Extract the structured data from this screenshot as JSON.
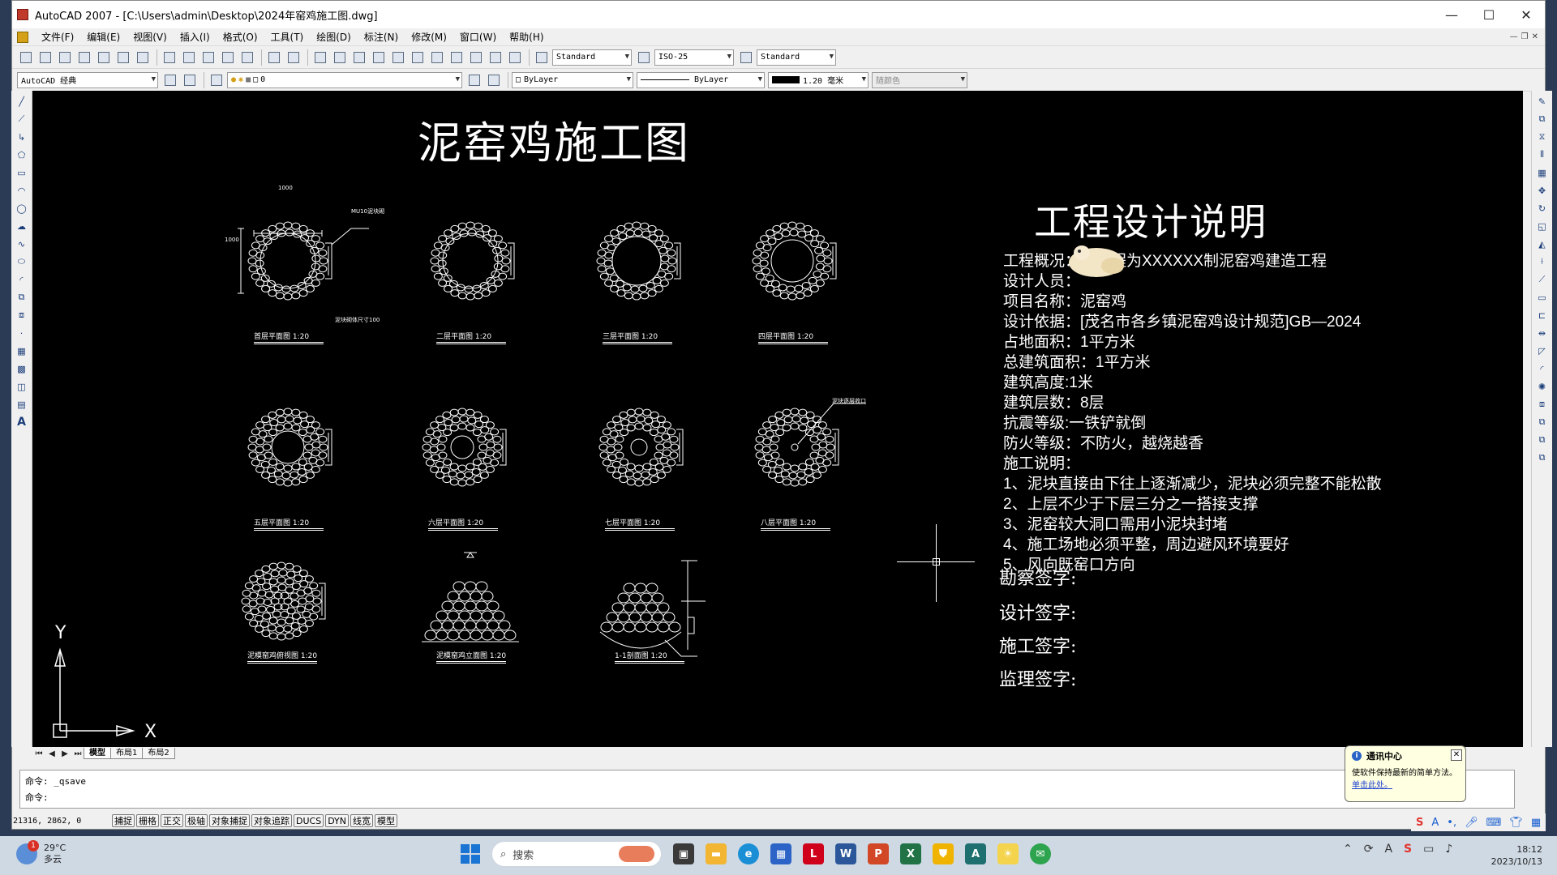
{
  "window": {
    "title": "AutoCAD 2007 - [C:\\Users\\admin\\Desktop\\2024年窑鸡施工图.dwg]",
    "controls": [
      "—",
      "☐",
      "✕"
    ]
  },
  "menu": {
    "items": [
      "文件(F)",
      "编辑(E)",
      "视图(V)",
      "插入(I)",
      "格式(O)",
      "工具(T)",
      "绘图(D)",
      "标注(N)",
      "修改(M)",
      "窗口(W)",
      "帮助(H)"
    ]
  },
  "toolbar1": {
    "text_style": "Standard",
    "dim_style": "ISO-25",
    "table_style": "Standard"
  },
  "toolbar2": {
    "workspace": "AutoCAD 经典",
    "layer": "0",
    "color": "ByLayer",
    "linetype": "ByLayer",
    "lineweight": "1.20 毫米",
    "plotstyle": "随颜色"
  },
  "drawing": {
    "title": "泥窑鸡施工图",
    "plans": [
      {
        "label": "首层平面图  1:20",
        "note_top": "1000",
        "note_side": "1000",
        "note_mud": "MU10泥块砌",
        "note_bottom": "泥块砌体尺寸100"
      },
      {
        "label": "二层平面图  1:20"
      },
      {
        "label": "三层平面图  1:20"
      },
      {
        "label": "四层平面图  1:20"
      },
      {
        "label": "五层平面图  1:20"
      },
      {
        "label": "六层平面图  1:20"
      },
      {
        "label": "七层平面图  1:20"
      },
      {
        "label": "八层平面图  1:20",
        "note_top": "泥块逐层收口"
      },
      {
        "label": "泥模窑鸡俯视图  1:20"
      },
      {
        "label": "泥模窑鸡立面图  1:20"
      },
      {
        "label": "1-1剖面图  1:20"
      }
    ],
    "spec_heading": "工程设计说明",
    "spec_lines": [
      "工程概况：本工程为XXXXXX制泥窑鸡建造工程",
      "设计人员：",
      "项目名称：泥窑鸡",
      "设计依据：[茂名市各乡镇泥窑鸡设计规范]GB—2024",
      "占地面积：1平方米",
      "总建筑面积：1平方米",
      "建筑高度:1米",
      "建筑层数：8层",
      "抗震等级:一铁铲就倒",
      "防火等级：不防火，越烧越香",
      "施工说明：",
      "1、泥块直接由下往上逐渐减少，泥块必须完整不能松散",
      "2、上层不少于下层三分之一搭接支撑",
      "3、泥窑较大洞口需用小泥块封堵",
      "4、施工场地必须平整，周边避风环境要好",
      "5、风向既窑口方向"
    ],
    "signatures": [
      "勘察签字:",
      "设计签字:",
      "施工签字:",
      "监理签字:"
    ],
    "ucs_x": "X",
    "ucs_y": "Y"
  },
  "layout_tabs": [
    "模型",
    "布局1",
    "布局2"
  ],
  "command": {
    "line1": "命令: _qsave",
    "line2": "命令:"
  },
  "status": {
    "coords": "21316, 2862, 0",
    "buttons": [
      "捕捉",
      "栅格",
      "正交",
      "极轴",
      "对象捕捉",
      "对象追踪",
      "DUCS",
      "DYN",
      "线宽",
      "模型"
    ]
  },
  "balloon": {
    "title": "通讯中心",
    "text": "使软件保持最新的简单方法。",
    "link": "单击此处。"
  },
  "taskbar": {
    "temp": "29°C",
    "weather": "多云",
    "badge": "1",
    "search": "搜索",
    "time": "18:12",
    "date": "2023/10/13"
  },
  "colors": {
    "canvas": "#000000",
    "accent": "#1a74d4"
  }
}
